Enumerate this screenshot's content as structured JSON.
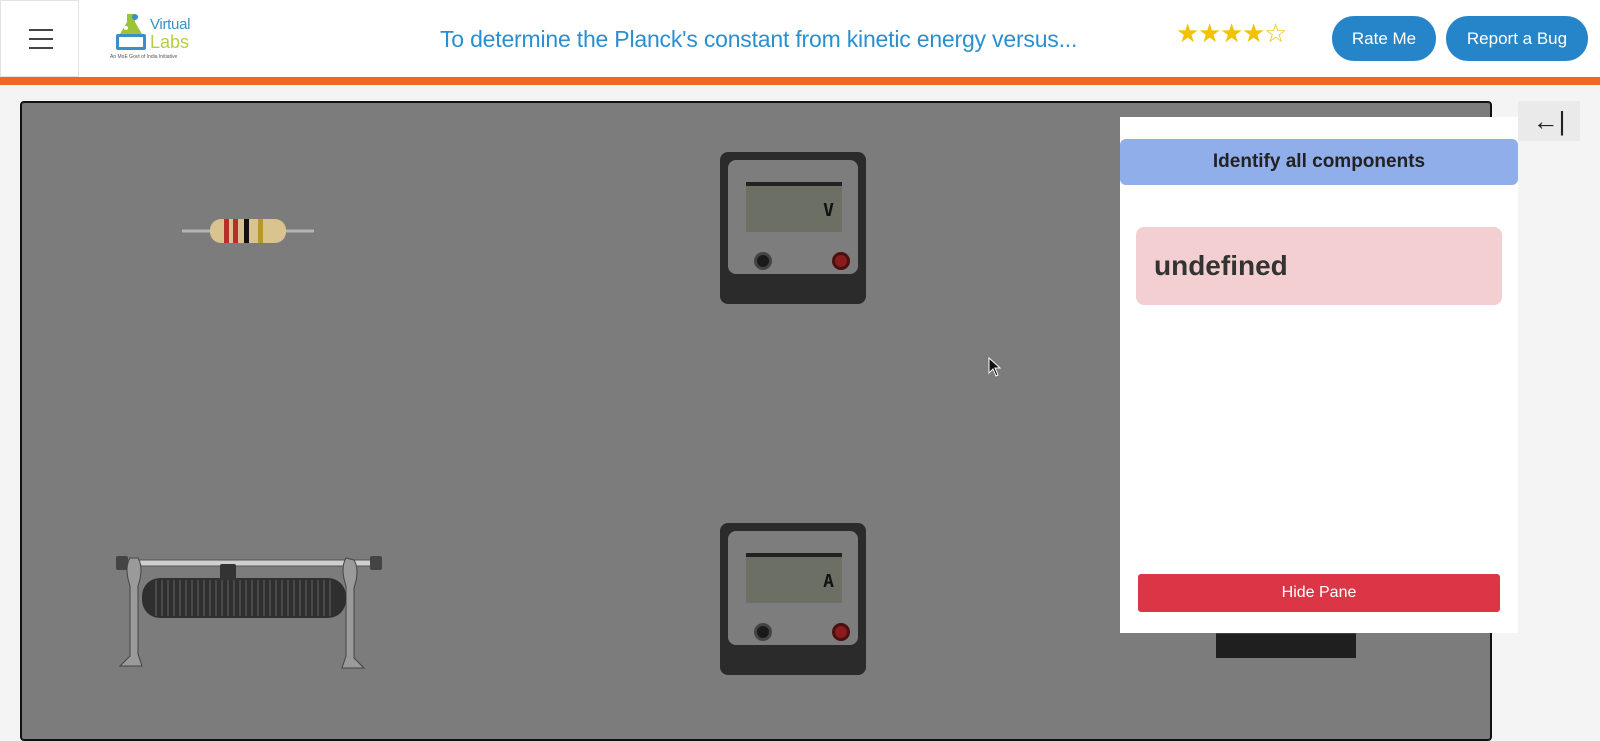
{
  "header": {
    "menu_icon": "hamburger-menu-icon",
    "logo": {
      "line1": "Virtual",
      "line2": "Labs",
      "tagline": "An MoE Govt of India Initiative"
    },
    "title": "To determine the Planck's constant from kinetic energy versus...",
    "rating": {
      "filled": 4,
      "max": 5,
      "filled_glyph": "★",
      "empty_glyph": "☆"
    },
    "rate_button": "Rate Me",
    "bug_button": "Report a Bug",
    "accent_color": "#f26522"
  },
  "workspace": {
    "collapse_icon": "←|",
    "voltmeter_label": "V",
    "ammeter_label": "A"
  },
  "pane": {
    "title": "Identify all components",
    "message": "undefined",
    "hide_button": "Hide Pane"
  },
  "colors": {
    "brand_blue": "#2585c8",
    "pane_header": "#90aee9",
    "message_bg": "#f3cfd1",
    "danger": "#dc3545"
  }
}
